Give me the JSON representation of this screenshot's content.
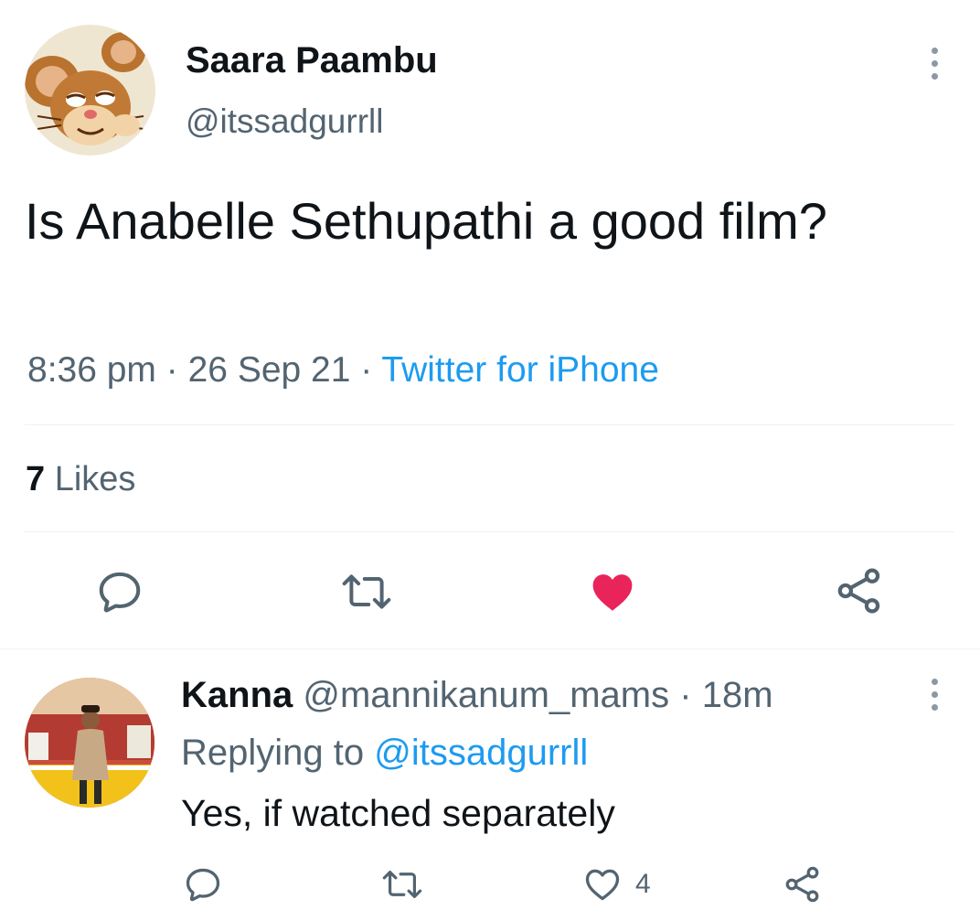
{
  "tweet": {
    "author": {
      "name": "Saara Paambu",
      "handle": "@itssadgurrll",
      "avatar_icon": "cartoon-mouse-avatar"
    },
    "text": "Is Anabelle Sethupathi a good film?",
    "time": "8:36 pm",
    "separator": "·",
    "date": "26 Sep 21",
    "source": "Twitter for iPhone",
    "likes_count": "7",
    "likes_label": "Likes",
    "liked": true,
    "actions": [
      "reply-icon",
      "retweet-icon",
      "heart-filled-icon",
      "share-icon"
    ]
  },
  "reply": {
    "author": {
      "name": "Kanna",
      "handle": "@mannikanum_mams",
      "avatar_icon": "person-photo-avatar"
    },
    "separator": "·",
    "age": "18m",
    "replying_label": "Replying to",
    "replying_to": "@itssadgurrll",
    "text": "Yes, if watched separately",
    "like_count": "4",
    "actions": [
      "reply-icon",
      "retweet-icon",
      "heart-outline-icon",
      "share-icon"
    ]
  },
  "colors": {
    "accent": "#1d9bf0",
    "like": "#f91880",
    "text": "#0f1419",
    "secondary": "#536471",
    "divider": "#eff3f4"
  }
}
